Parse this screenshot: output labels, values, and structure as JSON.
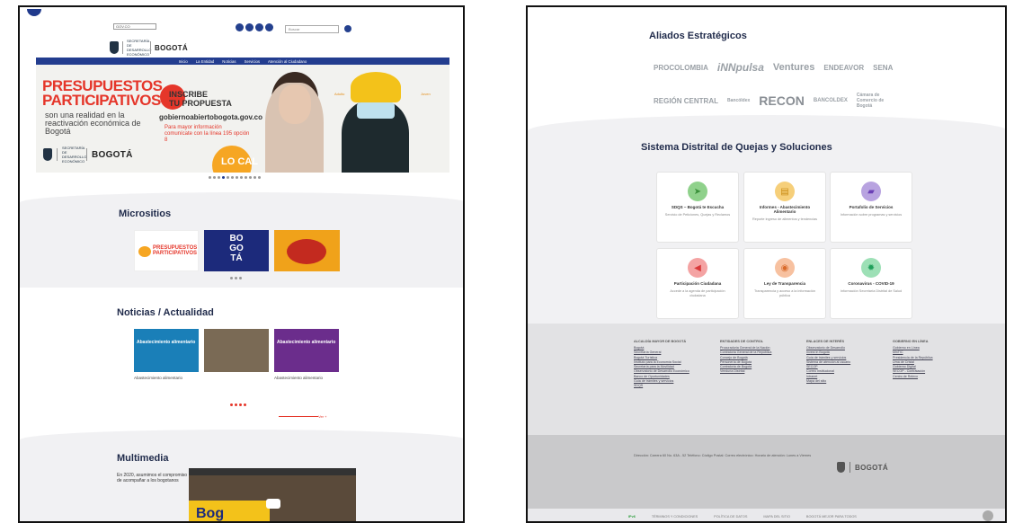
{
  "left": {
    "gov_badge": "GOV.CO",
    "sec_dev": "SECRETARÍA DE DESARROLLO ECONÓMICO",
    "bogota": "BOGOTÁ",
    "search_placeholder": "Buscar",
    "nav": [
      "Inicio",
      "La Entidad",
      "Noticias",
      "Servicios",
      "Atención al Ciudadano"
    ],
    "hero": {
      "title_line1": "PRESUPUESTOS",
      "title_line2": "PARTICIPATIVOS",
      "subtitle": "son una realidad en la reactivación económica de Bogotá",
      "inscribe_1": "INSCRIBE",
      "inscribe_2": "TU PROPUESTA",
      "url": "gobiernoabiertobogota.gov.co",
      "info": "Para mayor información comunícate con la línea 195 opción 8",
      "local": "LO CAL",
      "adulto": "Adulto",
      "joven": "Joven"
    },
    "micrositios": {
      "title": "Micrositios",
      "tile1": "PRESUPUESTOS PARTICIPATIVOS",
      "tile2": "BO GO TÁ"
    },
    "noticias": {
      "title": "Noticias / Actualidad",
      "items": [
        {
          "label": "Abastecimiento alimentario",
          "date": "",
          "caption": "Abastecimiento alimentario"
        },
        {
          "label": "",
          "date": "",
          "caption": ""
        },
        {
          "label": "Abastecimiento alimentario",
          "date": "",
          "caption": "Abastecimiento alimentario"
        }
      ],
      "ver_mas": "Ver +"
    },
    "multimedia": {
      "title": "Multimedia",
      "text": "En 2020, asumimos el compromiso de acompañar a los bogotanos",
      "video_logo": "Bog"
    }
  },
  "right": {
    "aliados_title": "Aliados Estratégicos",
    "allies_row1": [
      "PROCOLOMBIA",
      "iNNpulsa",
      "Ventures",
      "ENDEAVOR",
      "SENA"
    ],
    "allies_row2": [
      "REGIÓN CENTRAL",
      "Bancóldex",
      "RECON",
      "BANCOLDEX",
      "Cámara de Comercio de Bogotá"
    ],
    "quejas_title": "Sistema Distrital de Quejas y Soluciones",
    "cards": [
      {
        "title": "SDQS – Bogotá te Escucha",
        "desc": "Servicio de Peticiones, Quejas y Reclamos",
        "icon": "paper-plane-icon",
        "color": "#8fd18b",
        "fg": "#3a8f3a"
      },
      {
        "title": "Informes - Abastecimiento Alimentario",
        "desc": "Reporte ingreso de alimentos y tendencias",
        "icon": "document-icon",
        "color": "#f6cf7a",
        "fg": "#c98a12"
      },
      {
        "title": "Portafolio de Servicios",
        "desc": "Información sobre programas y servicios",
        "icon": "folder-icon",
        "color": "#b8a3e0",
        "fg": "#6a3fb5"
      },
      {
        "title": "Participación Ciudadana",
        "desc": "Accede a la agenda de participación ciudadana",
        "icon": "megaphone-icon",
        "color": "#f4a3a3",
        "fg": "#d9383a"
      },
      {
        "title": "Ley de Transparencia",
        "desc": "Transparencia y acceso a la información pública",
        "icon": "eye-icon",
        "color": "#f7c1a0",
        "fg": "#d96a2a"
      },
      {
        "title": "Coronavirus - COVID-19",
        "desc": "Información Secretaría Distrital de Salud",
        "icon": "virus-icon",
        "color": "#9de0b6",
        "fg": "#1f9f5a"
      }
    ],
    "footer": {
      "cols": [
        {
          "head": "ALCALDÍA MAYOR DE BOGOTÁ",
          "items": [
            "Bogotá",
            "Secretaría General",
            "Bogotá Turística",
            "Instituto para la Economía Social",
            "Secretaría para la Movilidad",
            "Observatorio de Desarrollo Económico",
            "Banco de Oportunidades",
            "Guía de trámites y servicios",
            "SDQS"
          ]
        },
        {
          "head": "ENTIDADES DE CONTROL",
          "items": [
            "Procuraduría General de la Nación",
            "Contraloría General de la República",
            "Concejo de Bogotá",
            "Personería de Bogotá",
            "Contraloría de Bogotá",
            "Veeduría Distrital"
          ]
        },
        {
          "head": "ENLACES DE INTERÉS",
          "items": [
            "Observatorio de Desarrollo",
            "Invest in Bogotá",
            "Guía de trámites y servicios",
            "Sistema de atención al usuario",
            "SECOP",
            "Correo Institucional",
            "Intranet",
            "Mapa del sitio"
          ]
        },
        {
          "head": "GOBIERNO EN LÍNEA",
          "items": [
            "Gobierno en Línea",
            "MinTIC",
            "Presidencia de la República",
            "Urna de Cristal",
            "Gobierno Digital",
            "SECOP - Contratación",
            "Centro de Relevo"
          ]
        }
      ],
      "address": "Dirección: Carrera 60 No. 63A - 52 Teléfono: Código Postal: Correo electrónico: Horario de atención: Lunes a Viernes"
    },
    "status": [
      "IPv6",
      "TÉRMINOS Y CONDICIONES",
      "POLÍTICA DE DATOS",
      "MAPA DEL SITIO",
      "BOGOTÁ MEJOR PARA TODOS"
    ]
  }
}
